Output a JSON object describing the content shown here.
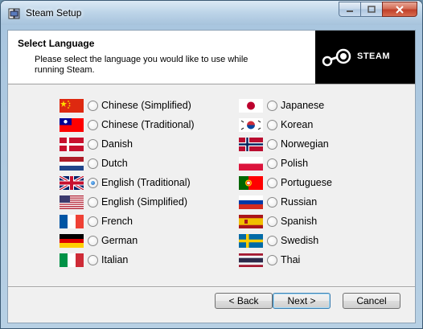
{
  "window": {
    "title": "Steam Setup"
  },
  "header": {
    "title": "Select Language",
    "subtitle": "Please select the language you would like to use while running Steam.",
    "logo_text": "STEAM"
  },
  "languages_left": [
    {
      "label": "Chinese (Simplified)",
      "flag": "china-flag-icon",
      "checked": false
    },
    {
      "label": "Chinese (Traditional)",
      "flag": "taiwan-flag-icon",
      "checked": false
    },
    {
      "label": "Danish",
      "flag": "denmark-flag-icon",
      "checked": false
    },
    {
      "label": "Dutch",
      "flag": "netherlands-flag-icon",
      "checked": false
    },
    {
      "label": "English (Traditional)",
      "flag": "uk-flag-icon",
      "checked": true
    },
    {
      "label": "English (Simplified)",
      "flag": "usa-flag-icon",
      "checked": false
    },
    {
      "label": "French",
      "flag": "france-flag-icon",
      "checked": false
    },
    {
      "label": "German",
      "flag": "germany-flag-icon",
      "checked": false
    },
    {
      "label": "Italian",
      "flag": "italy-flag-icon",
      "checked": false
    }
  ],
  "languages_right": [
    {
      "label": "Japanese",
      "flag": "japan-flag-icon",
      "checked": false
    },
    {
      "label": "Korean",
      "flag": "korea-flag-icon",
      "checked": false
    },
    {
      "label": "Norwegian",
      "flag": "norway-flag-icon",
      "checked": false
    },
    {
      "label": "Polish",
      "flag": "poland-flag-icon",
      "checked": false
    },
    {
      "label": "Portuguese",
      "flag": "portugal-flag-icon",
      "checked": false
    },
    {
      "label": "Russian",
      "flag": "russia-flag-icon",
      "checked": false
    },
    {
      "label": "Spanish",
      "flag": "spain-flag-icon",
      "checked": false
    },
    {
      "label": "Swedish",
      "flag": "sweden-flag-icon",
      "checked": false
    },
    {
      "label": "Thai",
      "flag": "thailand-flag-icon",
      "checked": false
    }
  ],
  "buttons": {
    "back": "< Back",
    "next": "Next >",
    "cancel": "Cancel"
  },
  "colors": {
    "logo_bg": "#000000",
    "default_button_border": "#3c7fb1"
  }
}
